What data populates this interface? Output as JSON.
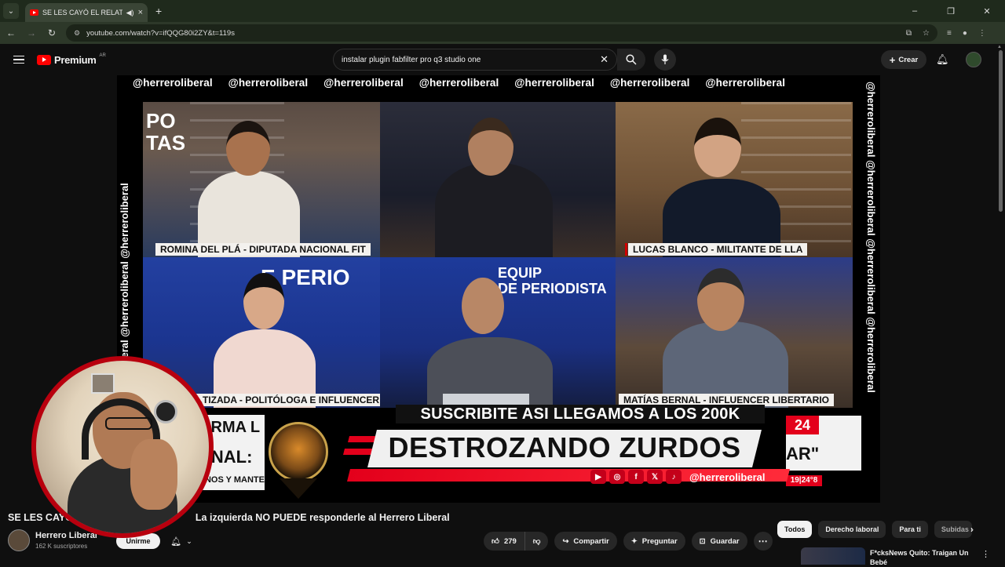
{
  "browser": {
    "tab_title": "SE LES CAYÓ EL RELATO EN",
    "url": "youtube.com/watch?v=ifQQG80i2ZY&t=119s",
    "new_tab": "+",
    "tab_close": "×",
    "window_controls": [
      "–",
      "❐",
      "✕"
    ]
  },
  "header": {
    "logo_text": "Premium",
    "logo_country": "AR",
    "search_value": "instalar plugin fabfilter pro q3 studio one",
    "create_label": "Crear"
  },
  "video": {
    "handle": "@herreroliberal",
    "top_handles": [
      "@herreroliberal",
      "@herreroliberal",
      "@herreroliberal",
      "@herreroliberal",
      "@herreroliberal",
      "@herreroliberal",
      "@herreroliberal"
    ],
    "side_handles": "@herreroliberal @herreroliberal @herreroliberal @herreroliberal",
    "panel_labels": {
      "p1": "ROMINA DEL PLÁ - DIPUTADA NACIONAL FIT",
      "p3": "LUCAS BLANCO - MILITANTE DE LLA",
      "p4": "...TIZADA - POLITÓLOGA E INFLUENCER K",
      "p6": "MATÍAS BERNAL - INFLUENCER LIBERTARIO"
    },
    "tv_words": {
      "c1": "PO\nTAS",
      "c4": "E PERIO",
      "c5": "EQUIP\nDE PERIODISTA"
    },
    "banner_top": "SUSCRIBITE ASI LLEGAMOS A LOS 200K",
    "banner_main": "DESTROZANDO ZURDOS",
    "social_handle": "@herreroliberal",
    "social_icons": [
      "▶",
      "◎",
      "f",
      "𝕏",
      "♪"
    ],
    "ticker_num": "24",
    "ticker_quote": "AR\"",
    "ticker_time": "19|24°8",
    "left_lower_lines": [
      "ORMA L",
      "RNAL:",
      "ANOS Y MANTE"
    ]
  },
  "below": {
    "title_part1": "SE LES CAYÓ",
    "title_part2": "La izquierda NO PUEDE responderle al Herrero Liberal",
    "channel_name": "Herrero Liberal",
    "channel_subs": "162 K suscriptores",
    "subscribe_label": "Unirme",
    "like_count": "279",
    "share_label": "Compartir",
    "ask_label": "Preguntar",
    "save_label": "Guardar"
  },
  "chips": [
    "Todos",
    "Derecho laboral",
    "Para ti",
    "Subidas r"
  ],
  "recommendation": {
    "title": "F*cksNews Quito: Traigan Un Bebé"
  }
}
